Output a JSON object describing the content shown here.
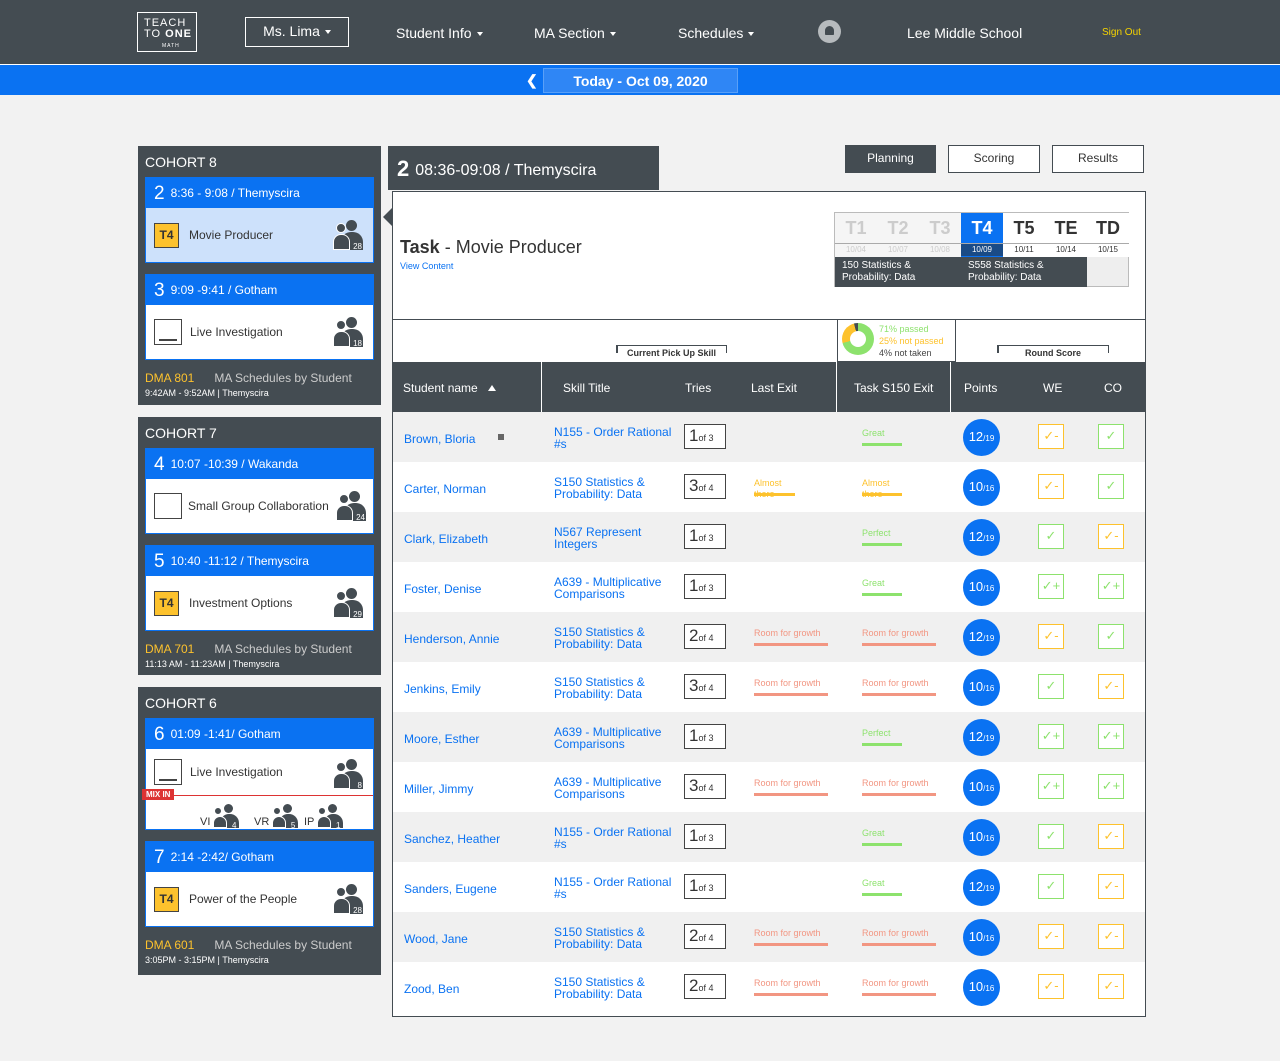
{
  "header": {
    "logo": {
      "line1": "TEACH",
      "line2a": "TO ",
      "line2b": "ONE",
      "line3": "MATH"
    },
    "user": "Ms. Lima",
    "nav": [
      "Student Info",
      "MA Section",
      "Schedules"
    ],
    "school": "Lee Middle School",
    "signout": "Sign Out"
  },
  "datebar": {
    "date": "Today - Oct 09, 2020"
  },
  "cohorts": [
    {
      "title": "COHORT 8",
      "sessions": [
        {
          "num": "2",
          "time": "8:36 - 9:08 / Themyscira",
          "tag": "T4",
          "label": "Movie Producer",
          "count": "28"
        },
        {
          "num": "3",
          "time": "9:09 -9:41 / Gotham",
          "label": "Live Investigation",
          "count": "18"
        }
      ],
      "dma": "DMA 801",
      "dma_link": "MA Schedules by Student",
      "dma_time": "9:42AM - 9:52AM | Themyscira"
    },
    {
      "title": "COHORT 7",
      "sessions": [
        {
          "num": "4",
          "time": "10:07 -10:39 / Wakanda",
          "label": "Small Group Collaboration",
          "count": "24"
        },
        {
          "num": "5",
          "time": "10:40 -11:12 / Themyscira",
          "tag": "T4",
          "label": "Investment Options",
          "count": "29"
        }
      ],
      "dma": "DMA 701",
      "dma_link": "MA Schedules by Student",
      "dma_time": "11:13 AM - 11:23AM | Themyscira"
    },
    {
      "title": "COHORT 6",
      "sessions": [
        {
          "num": "6",
          "time": "01:09 -1:41/ Gotham",
          "label": "Live Investigation",
          "count": "8",
          "mix": {
            "tag": "MIX IN",
            "groups": [
              {
                "label": "VI",
                "count": "4"
              },
              {
                "label": "VR",
                "count": "5"
              },
              {
                "label": "IP",
                "count": "1"
              }
            ]
          }
        },
        {
          "num": "7",
          "time": "2:14 -2:42/ Gotham",
          "tag": "T4",
          "label": "Power of the People",
          "count": "28"
        }
      ],
      "dma": "DMA 601",
      "dma_link": "MA Schedules by Student",
      "dma_time": "3:05PM - 3:15PM | Themyscira"
    }
  ],
  "panel": {
    "head_num": "2",
    "head_text": "08:36-09:08 / Themyscira",
    "tabs": [
      "Planning",
      "Scoring",
      "Results"
    ],
    "task_label": "Task",
    "task_name": "- Movie Producer",
    "view_content": "View Content",
    "timeline": [
      {
        "t": "T1",
        "d": "10/04"
      },
      {
        "t": "T2",
        "d": "10/07"
      },
      {
        "t": "T3",
        "d": "10/08"
      },
      {
        "t": "T4",
        "d": "10/09"
      },
      {
        "t": "T5",
        "d": "10/11"
      },
      {
        "t": "TE",
        "d": "10/14"
      },
      {
        "t": "TD",
        "d": "10/15"
      }
    ],
    "timeline_skill1": "150 Statistics & Probability: Data",
    "timeline_skill2": "S558 Statistics & Probability: Data",
    "pie": {
      "passed": "71% passed",
      "not_passed": "25% not passed",
      "not_taken": "4% not taken"
    },
    "group_cpus": "Current Pick Up Skill",
    "group_round": "Round Score",
    "columns": [
      "Student name",
      "Skill Title",
      "Tries",
      "Last Exit",
      "Task S150 Exit",
      "Points",
      "WE",
      "CO"
    ]
  },
  "rows": [
    {
      "name": "Brown, Bloria",
      "skill": "N155 - Order Rational #s",
      "t1": "1",
      "t2": "of 3",
      "le": "",
      "lec": "",
      "te": "Great",
      "tec": "green",
      "p1": "12",
      "p2": "/19",
      "we": "✓-",
      "wec": "y",
      "co": "✓",
      "coc": "g"
    },
    {
      "name": "Carter, Norman",
      "skill": "S150 Statistics & Probability: Data",
      "t1": "3",
      "t2": "of 4",
      "le": "Almost there",
      "lec": "yellow",
      "te": "Almost there",
      "tec": "yellow",
      "p1": "10",
      "p2": "/16",
      "we": "✓-",
      "wec": "y",
      "co": "✓",
      "coc": "g"
    },
    {
      "name": "Clark, Elizabeth",
      "skill": "N567 Represent Integers",
      "t1": "1",
      "t2": "of 3",
      "le": "",
      "lec": "",
      "te": "Perfect",
      "tec": "green",
      "p1": "12",
      "p2": "/19",
      "we": "✓",
      "wec": "g",
      "co": "✓-",
      "coc": "y"
    },
    {
      "name": "Foster, Denise",
      "skill": "A639 - Multiplicative Comparisons",
      "t1": "1",
      "t2": "of 3",
      "le": "",
      "lec": "",
      "te": "Great",
      "tec": "green",
      "p1": "10",
      "p2": "/16",
      "we": "✓+",
      "wec": "g",
      "co": "✓+",
      "coc": "g"
    },
    {
      "name": "Henderson, Annie",
      "skill": "S150 Statistics & Probability: Data",
      "t1": "2",
      "t2": "of 4",
      "le": "Room for growth",
      "lec": "red",
      "te": "Room for growth",
      "tec": "red",
      "p1": "12",
      "p2": "/19",
      "we": "✓-",
      "wec": "y",
      "co": "✓",
      "coc": "g"
    },
    {
      "name": "Jenkins, Emily",
      "skill": "S150 Statistics & Probability: Data",
      "t1": "3",
      "t2": "of 4",
      "le": "Room for growth",
      "lec": "red",
      "te": "Room for growth",
      "tec": "red",
      "p1": "10",
      "p2": "/16",
      "we": "✓",
      "wec": "g",
      "co": "✓-",
      "coc": "y"
    },
    {
      "name": "Moore, Esther",
      "skill": "A639 - Multiplicative Comparisons",
      "t1": "1",
      "t2": "of 3",
      "le": "",
      "lec": "",
      "te": "Perfect",
      "tec": "green",
      "p1": "12",
      "p2": "/19",
      "we": "✓+",
      "wec": "g",
      "co": "✓+",
      "coc": "g"
    },
    {
      "name": "Miller, Jimmy",
      "skill": "A639 - Multiplicative Comparisons",
      "t1": "3",
      "t2": "of 4",
      "le": "Room for growth",
      "lec": "red",
      "te": "Room for growth",
      "tec": "red",
      "p1": "10",
      "p2": "/16",
      "we": "✓+",
      "wec": "g",
      "co": "✓+",
      "coc": "g"
    },
    {
      "name": "Sanchez, Heather",
      "skill": "N155 - Order Rational #s",
      "t1": "1",
      "t2": "of 3",
      "le": "",
      "lec": "",
      "te": "Great",
      "tec": "green",
      "p1": "10",
      "p2": "/16",
      "we": "✓",
      "wec": "g",
      "co": "✓-",
      "coc": "y"
    },
    {
      "name": "Sanders, Eugene",
      "skill": "N155 - Order Rational #s",
      "t1": "1",
      "t2": "of 3",
      "le": "",
      "lec": "",
      "te": "Great",
      "tec": "green",
      "p1": "12",
      "p2": "/19",
      "we": "✓",
      "wec": "g",
      "co": "✓-",
      "coc": "y"
    },
    {
      "name": "Wood, Jane",
      "skill": "S150 Statistics & Probability: Data",
      "t1": "2",
      "t2": "of 4",
      "le": "Room for growth",
      "lec": "red",
      "te": "Room for growth",
      "tec": "red",
      "p1": "10",
      "p2": "/16",
      "we": "✓-",
      "wec": "y",
      "co": "✓-",
      "coc": "y"
    },
    {
      "name": "Zood, Ben",
      "skill": "S150 Statistics & Probability: Data",
      "t1": "2",
      "t2": "of 4",
      "le": "Room for growth",
      "lec": "red",
      "te": "Room for growth",
      "tec": "red",
      "p1": "10",
      "p2": "/16",
      "we": "✓-",
      "wec": "y",
      "co": "✓-",
      "coc": "y"
    }
  ],
  "colors": {
    "topbar": "#444c52",
    "accent": "#0a72f2",
    "tag": "#fdc22d",
    "green": "#8de26d",
    "yellow": "#fdc22d",
    "red": "#f29682"
  }
}
